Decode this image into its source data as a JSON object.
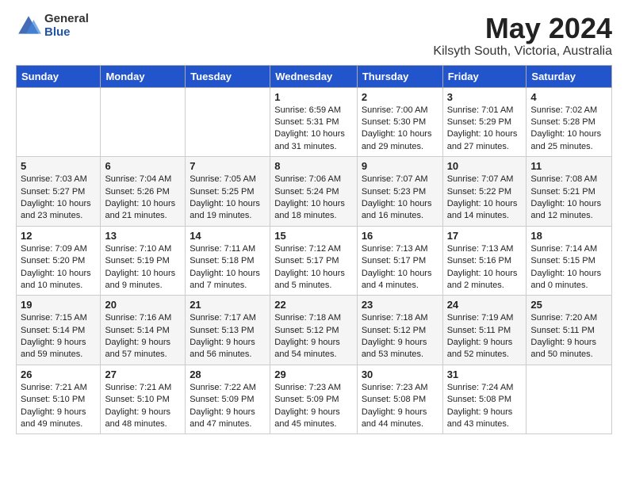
{
  "logo": {
    "general": "General",
    "blue": "Blue"
  },
  "title": "May 2024",
  "subtitle": "Kilsyth South, Victoria, Australia",
  "days_of_week": [
    "Sunday",
    "Monday",
    "Tuesday",
    "Wednesday",
    "Thursday",
    "Friday",
    "Saturday"
  ],
  "weeks": [
    [
      {
        "day": "",
        "info": ""
      },
      {
        "day": "",
        "info": ""
      },
      {
        "day": "",
        "info": ""
      },
      {
        "day": "1",
        "info": "Sunrise: 6:59 AM\nSunset: 5:31 PM\nDaylight: 10 hours\nand 31 minutes."
      },
      {
        "day": "2",
        "info": "Sunrise: 7:00 AM\nSunset: 5:30 PM\nDaylight: 10 hours\nand 29 minutes."
      },
      {
        "day": "3",
        "info": "Sunrise: 7:01 AM\nSunset: 5:29 PM\nDaylight: 10 hours\nand 27 minutes."
      },
      {
        "day": "4",
        "info": "Sunrise: 7:02 AM\nSunset: 5:28 PM\nDaylight: 10 hours\nand 25 minutes."
      }
    ],
    [
      {
        "day": "5",
        "info": "Sunrise: 7:03 AM\nSunset: 5:27 PM\nDaylight: 10 hours\nand 23 minutes."
      },
      {
        "day": "6",
        "info": "Sunrise: 7:04 AM\nSunset: 5:26 PM\nDaylight: 10 hours\nand 21 minutes."
      },
      {
        "day": "7",
        "info": "Sunrise: 7:05 AM\nSunset: 5:25 PM\nDaylight: 10 hours\nand 19 minutes."
      },
      {
        "day": "8",
        "info": "Sunrise: 7:06 AM\nSunset: 5:24 PM\nDaylight: 10 hours\nand 18 minutes."
      },
      {
        "day": "9",
        "info": "Sunrise: 7:07 AM\nSunset: 5:23 PM\nDaylight: 10 hours\nand 16 minutes."
      },
      {
        "day": "10",
        "info": "Sunrise: 7:07 AM\nSunset: 5:22 PM\nDaylight: 10 hours\nand 14 minutes."
      },
      {
        "day": "11",
        "info": "Sunrise: 7:08 AM\nSunset: 5:21 PM\nDaylight: 10 hours\nand 12 minutes."
      }
    ],
    [
      {
        "day": "12",
        "info": "Sunrise: 7:09 AM\nSunset: 5:20 PM\nDaylight: 10 hours\nand 10 minutes."
      },
      {
        "day": "13",
        "info": "Sunrise: 7:10 AM\nSunset: 5:19 PM\nDaylight: 10 hours\nand 9 minutes."
      },
      {
        "day": "14",
        "info": "Sunrise: 7:11 AM\nSunset: 5:18 PM\nDaylight: 10 hours\nand 7 minutes."
      },
      {
        "day": "15",
        "info": "Sunrise: 7:12 AM\nSunset: 5:17 PM\nDaylight: 10 hours\nand 5 minutes."
      },
      {
        "day": "16",
        "info": "Sunrise: 7:13 AM\nSunset: 5:17 PM\nDaylight: 10 hours\nand 4 minutes."
      },
      {
        "day": "17",
        "info": "Sunrise: 7:13 AM\nSunset: 5:16 PM\nDaylight: 10 hours\nand 2 minutes."
      },
      {
        "day": "18",
        "info": "Sunrise: 7:14 AM\nSunset: 5:15 PM\nDaylight: 10 hours\nand 0 minutes."
      }
    ],
    [
      {
        "day": "19",
        "info": "Sunrise: 7:15 AM\nSunset: 5:14 PM\nDaylight: 9 hours\nand 59 minutes."
      },
      {
        "day": "20",
        "info": "Sunrise: 7:16 AM\nSunset: 5:14 PM\nDaylight: 9 hours\nand 57 minutes."
      },
      {
        "day": "21",
        "info": "Sunrise: 7:17 AM\nSunset: 5:13 PM\nDaylight: 9 hours\nand 56 minutes."
      },
      {
        "day": "22",
        "info": "Sunrise: 7:18 AM\nSunset: 5:12 PM\nDaylight: 9 hours\nand 54 minutes."
      },
      {
        "day": "23",
        "info": "Sunrise: 7:18 AM\nSunset: 5:12 PM\nDaylight: 9 hours\nand 53 minutes."
      },
      {
        "day": "24",
        "info": "Sunrise: 7:19 AM\nSunset: 5:11 PM\nDaylight: 9 hours\nand 52 minutes."
      },
      {
        "day": "25",
        "info": "Sunrise: 7:20 AM\nSunset: 5:11 PM\nDaylight: 9 hours\nand 50 minutes."
      }
    ],
    [
      {
        "day": "26",
        "info": "Sunrise: 7:21 AM\nSunset: 5:10 PM\nDaylight: 9 hours\nand 49 minutes."
      },
      {
        "day": "27",
        "info": "Sunrise: 7:21 AM\nSunset: 5:10 PM\nDaylight: 9 hours\nand 48 minutes."
      },
      {
        "day": "28",
        "info": "Sunrise: 7:22 AM\nSunset: 5:09 PM\nDaylight: 9 hours\nand 47 minutes."
      },
      {
        "day": "29",
        "info": "Sunrise: 7:23 AM\nSunset: 5:09 PM\nDaylight: 9 hours\nand 45 minutes."
      },
      {
        "day": "30",
        "info": "Sunrise: 7:23 AM\nSunset: 5:08 PM\nDaylight: 9 hours\nand 44 minutes."
      },
      {
        "day": "31",
        "info": "Sunrise: 7:24 AM\nSunset: 5:08 PM\nDaylight: 9 hours\nand 43 minutes."
      },
      {
        "day": "",
        "info": ""
      }
    ]
  ]
}
